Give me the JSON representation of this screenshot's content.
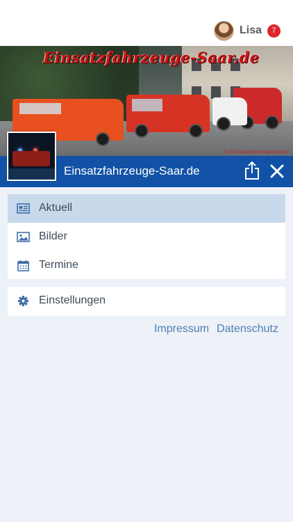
{
  "user": {
    "name": "Lisa",
    "badge_count": "7"
  },
  "header": {
    "banner_title": "Einsatzfahrzeuge-Saar.de",
    "banner_copyright": "© by Einsatzfahrzeuge-Saar.de",
    "site_name": "Einsatzfahrzeuge-Saar.de"
  },
  "menu": {
    "items": [
      {
        "label": "Aktuell",
        "icon": "news-icon",
        "active": true
      },
      {
        "label": "Bilder",
        "icon": "image-icon",
        "active": false
      },
      {
        "label": "Termine",
        "icon": "calendar-icon",
        "active": false
      }
    ],
    "settings": {
      "label": "Einstellungen",
      "icon": "gear-icon"
    }
  },
  "footer_links": {
    "impressum": "Impressum",
    "datenschutz": "Datenschutz"
  },
  "colors": {
    "accent": "#1152a6",
    "badge": "#e0262c",
    "active_row": "#c8d9ec",
    "link": "#4e7fb0",
    "background": "#edf1f8"
  }
}
